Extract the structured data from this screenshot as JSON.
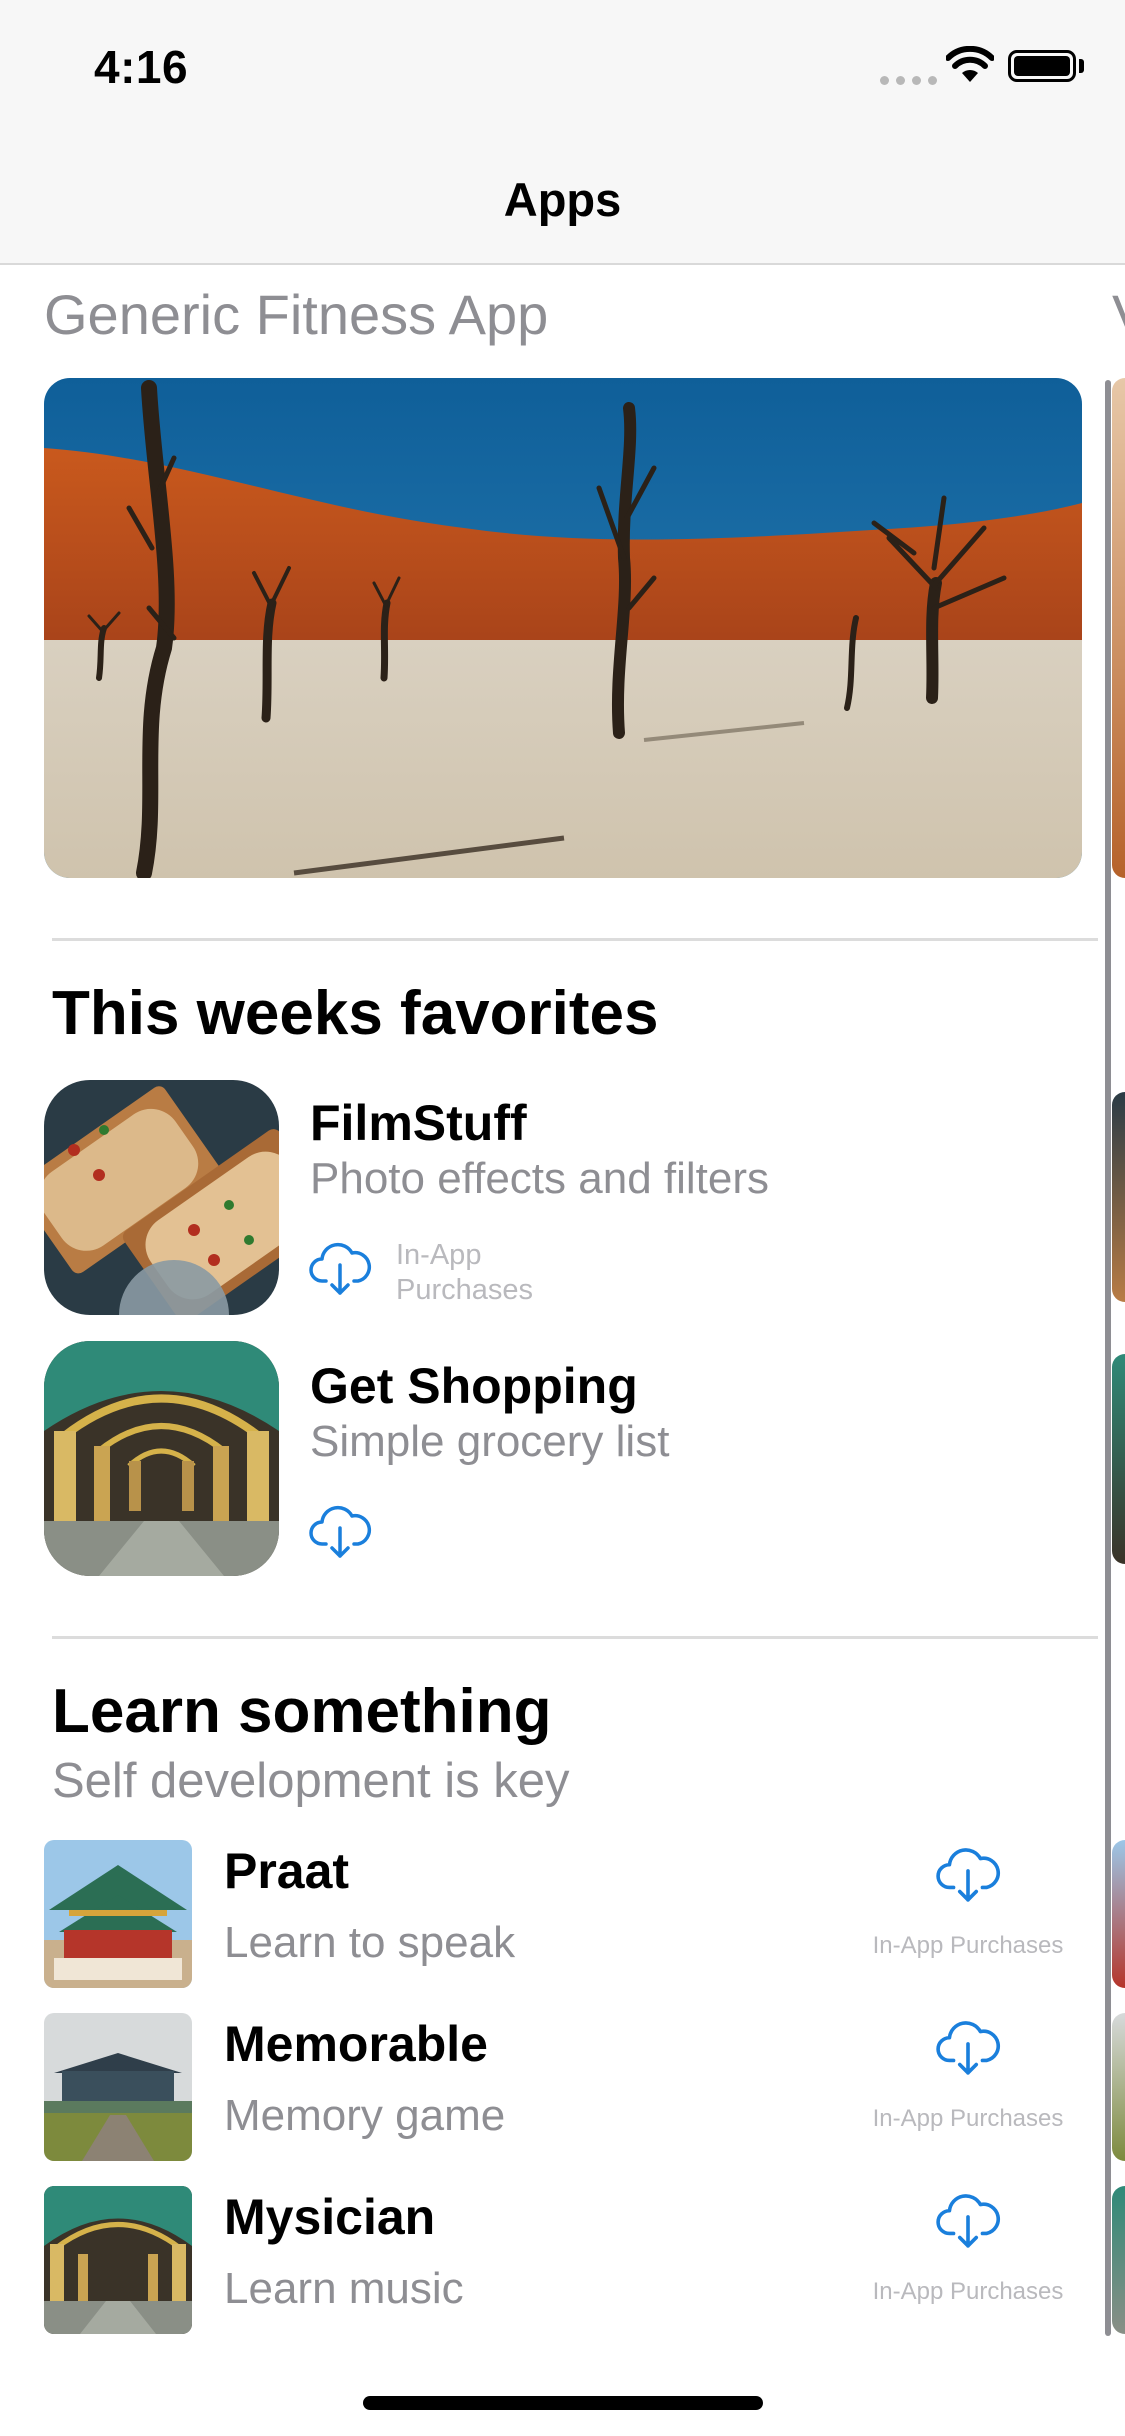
{
  "status_bar": {
    "time": "4:16"
  },
  "nav": {
    "title": "Apps"
  },
  "featured": {
    "title": "Generic Fitness App",
    "next_peek_title": "V"
  },
  "favorites": {
    "title": "This weeks favorites",
    "items": [
      {
        "name": "FilmStuff",
        "description": "Photo effects and filters",
        "badge": "In-App Purchases",
        "icon": "download-cloud-icon"
      },
      {
        "name": "Get Shopping",
        "description": "Simple grocery list",
        "badge": "",
        "icon": "download-cloud-icon"
      }
    ]
  },
  "learn": {
    "title": "Learn something",
    "subtitle": "Self development is key",
    "items": [
      {
        "name": "Praat",
        "description": "Learn to speak",
        "badge": "In-App Purchases",
        "icon": "download-cloud-icon"
      },
      {
        "name": "Memorable",
        "description": "Memory game",
        "badge": "In-App Purchases",
        "icon": "download-cloud-icon"
      },
      {
        "name": "Mysician",
        "description": "Learn music",
        "badge": "In-App Purchases",
        "icon": "download-cloud-icon"
      }
    ]
  },
  "colors": {
    "accent": "#1a7fdc",
    "secondary_text": "#8e8e93",
    "divider": "#dcdcdc"
  }
}
